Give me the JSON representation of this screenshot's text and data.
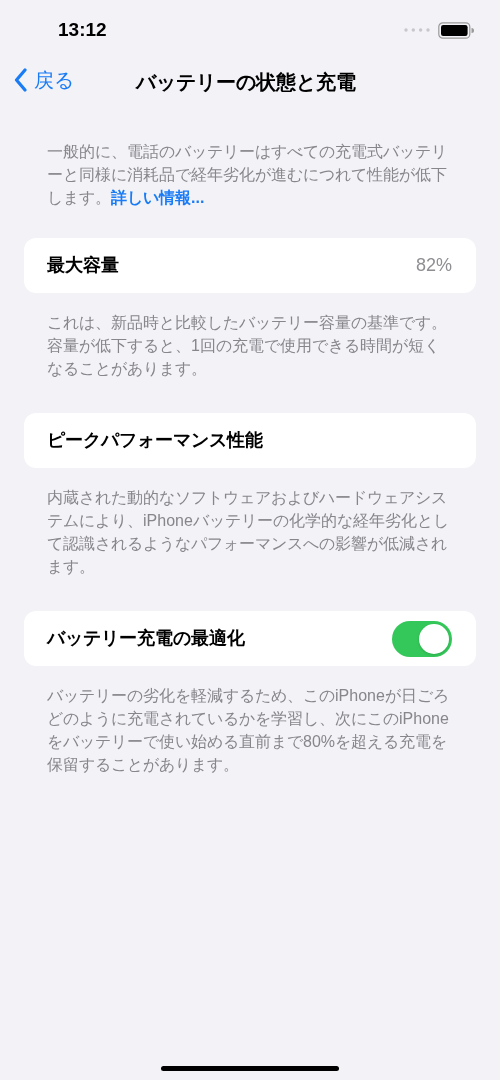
{
  "status_bar": {
    "time": "13:12"
  },
  "nav": {
    "back": "戻る",
    "title": "バッテリーの状態と充電"
  },
  "intro": {
    "text": "一般的に、電話のバッテリーはすべての充電式バッテリーと同様に消耗品で経年劣化が進むにつれて性能が低下します。",
    "link": "詳しい情報..."
  },
  "sections": [
    {
      "kind": "value",
      "title": "最大容量",
      "value": "82%",
      "footer": "これは、新品時と比較したバッテリー容量の基準です。容量が低下すると、1回の充電で使用できる時間が短くなることがあります。"
    },
    {
      "kind": "plain",
      "title": "ピークパフォーマンス性能",
      "footer": "内蔵された動的なソフトウェアおよびハードウェアシステムにより、iPhoneバッテリーの化学的な経年劣化として認識されるようなパフォーマンスへの影響が低減されます。"
    },
    {
      "kind": "toggle",
      "title": "バッテリー充電の最適化",
      "on": true,
      "footer": "バッテリーの劣化を軽減するため、このiPhoneが日ごろどのように充電されているかを学習し、次にこのiPhoneをバッテリーで使い始める直前まで80%を超える充電を保留することがあります。"
    }
  ]
}
